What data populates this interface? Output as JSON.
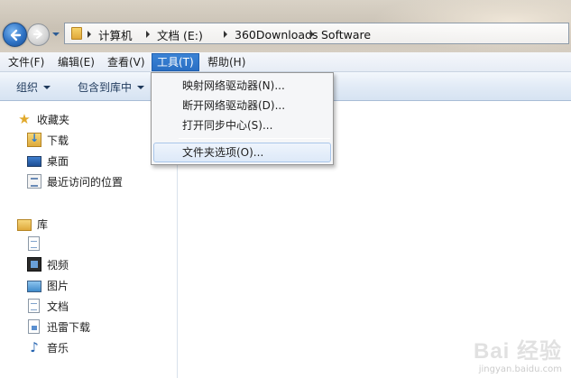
{
  "address_bar": {
    "crumbs": [
      "计算机",
      "文档 (E:)",
      "360Downloads",
      "Software"
    ]
  },
  "menubar": {
    "items": [
      "文件(F)",
      "编辑(E)",
      "查看(V)",
      "工具(T)",
      "帮助(H)"
    ],
    "active": "工具(T)"
  },
  "toolbar": {
    "organize": "组织",
    "include_in_library": "包含到库中"
  },
  "tools_menu": {
    "items": [
      "映射网络驱动器(N)...",
      "断开网络驱动器(D)...",
      "打开同步中心(S)...",
      "文件夹选项(O)..."
    ],
    "highlighted": "文件夹选项(O)..."
  },
  "nav_pane": {
    "favorites": {
      "label": "收藏夹",
      "items": [
        "下载",
        "桌面",
        "最近访问的位置"
      ]
    },
    "libraries": {
      "label": "库",
      "items": [
        "",
        "视频",
        "图片",
        "文档",
        "迅雷下载",
        "音乐"
      ]
    }
  },
  "watermark": {
    "main": "Bai 经验",
    "sub": "jingyan.baidu.com"
  }
}
